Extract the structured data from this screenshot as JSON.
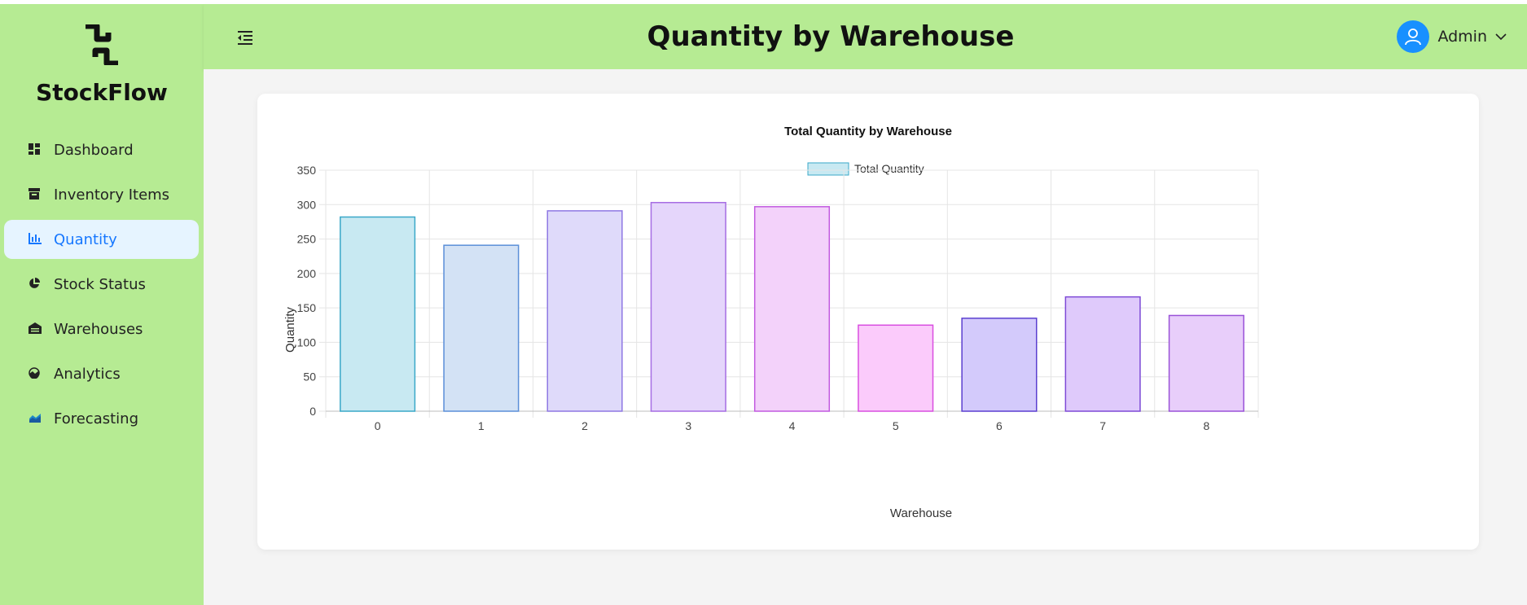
{
  "app": {
    "brand": "StockFlow"
  },
  "sidebar": {
    "items": [
      {
        "label": "Dashboard",
        "icon": "dashboard-icon"
      },
      {
        "label": "Inventory Items",
        "icon": "inbox-icon"
      },
      {
        "label": "Quantity",
        "icon": "bar-chart-icon",
        "active": true
      },
      {
        "label": "Stock Status",
        "icon": "pie-chart-icon"
      },
      {
        "label": "Warehouses",
        "icon": "warehouse-icon"
      },
      {
        "label": "Analytics",
        "icon": "fund-icon"
      },
      {
        "label": "Forecasting",
        "icon": "area-chart-icon"
      }
    ]
  },
  "header": {
    "title": "Quantity by Warehouse",
    "user": "Admin"
  },
  "colors": {
    "sidebar_bg": "#b6eb93",
    "active_bg": "#e6f4ff",
    "accent": "#1677ff",
    "avatar": "#1890ff"
  },
  "chart_data": {
    "type": "bar",
    "title": "Total Quantity by Warehouse",
    "xlabel": "Warehouse",
    "ylabel": "Quantity",
    "categories": [
      "0",
      "1",
      "2",
      "3",
      "4",
      "5",
      "6",
      "7",
      "8"
    ],
    "series": [
      {
        "name": "Total Quantity",
        "values": [
          282,
          241,
          291,
          303,
          297,
          125,
          135,
          166,
          139
        ]
      }
    ],
    "ylim": [
      0,
      350
    ],
    "yticks": [
      0,
      50,
      100,
      150,
      200,
      250,
      300,
      350
    ],
    "grid": true,
    "legend": "top-center",
    "bar_fills": [
      "#c8e9f2",
      "#d3e2f5",
      "#dfdafa",
      "#e5d6fb",
      "#f3d2fa",
      "#fbcbfb",
      "#d3cafb",
      "#dfcafb",
      "#e8cefa"
    ],
    "bar_strokes": [
      "#3aa8c8",
      "#5b8fd8",
      "#8f78e3",
      "#a66de3",
      "#c25ae0",
      "#d94ee0",
      "#5b3fd0",
      "#7e4ad6",
      "#9a52d8"
    ]
  }
}
